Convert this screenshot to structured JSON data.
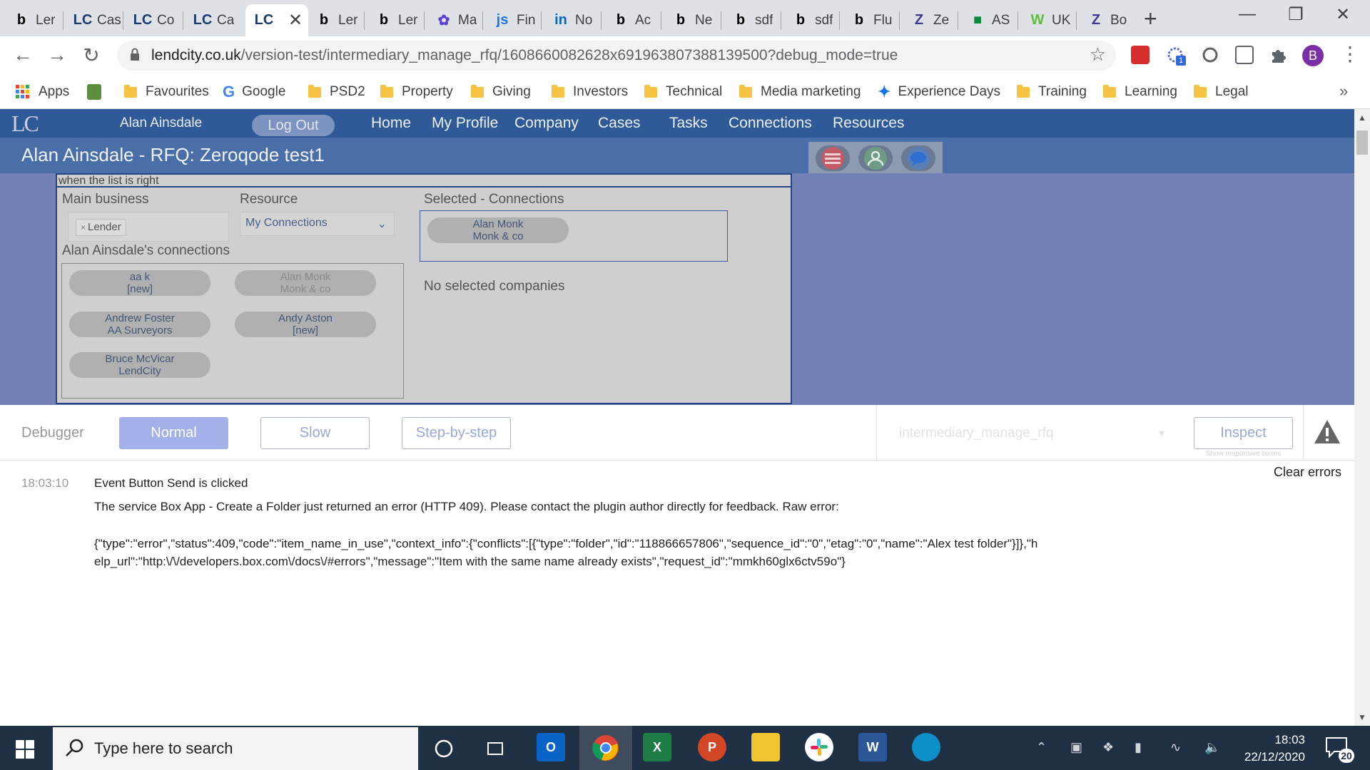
{
  "browser": {
    "tabs": [
      {
        "icon": "b",
        "title": "Ler",
        "color": "#000000"
      },
      {
        "icon": "LC",
        "title": "Cas",
        "color": "#1d3b6e"
      },
      {
        "icon": "LC",
        "title": "Co",
        "color": "#1d3b6e"
      },
      {
        "icon": "LC",
        "title": "Ca",
        "color": "#1d3b6e"
      },
      {
        "icon": "LC",
        "title": "",
        "color": "#1d3b6e",
        "active": true
      },
      {
        "icon": "b",
        "title": "Ler",
        "color": "#000000"
      },
      {
        "icon": "b",
        "title": "Ler",
        "color": "#000000"
      },
      {
        "icon": "✿",
        "title": "Ma",
        "color": "#5b3fd6"
      },
      {
        "icon": "js",
        "title": "Fin",
        "color": "#1a73e8"
      },
      {
        "icon": "in",
        "title": "No",
        "color": "#0a66c2"
      },
      {
        "icon": "b",
        "title": "Ac",
        "color": "#000000"
      },
      {
        "icon": "b",
        "title": "Ne",
        "color": "#000000"
      },
      {
        "icon": "b",
        "title": "sdf",
        "color": "#000000"
      },
      {
        "icon": "b",
        "title": "sdf",
        "color": "#000000"
      },
      {
        "icon": "b",
        "title": "Flu",
        "color": "#000000"
      },
      {
        "icon": "Z",
        "title": "Ze",
        "color": "#3b3b8f"
      },
      {
        "icon": "■",
        "title": "AS",
        "color": "#0f8a3b"
      },
      {
        "icon": "W",
        "title": "UK",
        "color": "#5fbf3a"
      },
      {
        "icon": "Z",
        "title": "Bo",
        "color": "#3b3b8f"
      }
    ],
    "url_host": "lendcity.co.uk",
    "url_path": "/version-test/intermediary_manage_rfq/1608660082628x691963807388139500?debug_mode=true",
    "profile_initial": "B",
    "extension_badge": "1"
  },
  "bookmarks": {
    "apps": "Apps",
    "items": [
      "Favourites",
      "Google",
      "PSD2",
      "Property",
      "Giving",
      "Investors",
      "Technical",
      "Media marketing",
      "Experience Days",
      "Training",
      "Learning",
      "Legal"
    ]
  },
  "app": {
    "logo": "LC",
    "user_name": "Alan Ainsdale",
    "logout": "Log Out",
    "nav": [
      "Home",
      "My Profile",
      "Company",
      "Cases",
      "Tasks",
      "Connections",
      "Resources"
    ],
    "page_title": "Alan Ainsdale -  RFQ: Zeroqode test1",
    "panel_note": "when the list is right",
    "main_business_label": "Main business",
    "main_business_tag": "Lender",
    "resource_label": "Resource",
    "resource_value": "My Connections",
    "connections_label": "Alan Ainsdale's connections",
    "connections": [
      {
        "name": "aa k",
        "sub": "[new]",
        "dim": false
      },
      {
        "name": "Alan Monk",
        "sub": "Monk & co",
        "dim": true
      },
      {
        "name": "Andrew Foster",
        "sub": "AA Surveyors",
        "dim": false
      },
      {
        "name": "Andy Aston",
        "sub": "[new]",
        "dim": false
      },
      {
        "name": "Bruce McVicar",
        "sub": "LendCity",
        "dim": false
      }
    ],
    "selected_label": "Selected - Connections",
    "selected": {
      "name": "Alan Monk",
      "sub": "Monk & co"
    },
    "no_companies": "No selected companies"
  },
  "debugger": {
    "label": "Debugger",
    "modes": [
      "Normal",
      "Slow",
      "Step-by-step"
    ],
    "active_mode": "Normal",
    "page_select": "intermediary_manage_rfq",
    "inspect": "Inspect",
    "inspect_sub": "Show responsive boxes",
    "clear_errors": "Clear errors"
  },
  "log": {
    "time": "18:03:10",
    "event": "Event Button Send is clicked",
    "message": "The service Box App - Create a Folder just returned an error (HTTP 409). Please contact the plugin author directly for feedback. Raw error:",
    "raw": "{\"type\":\"error\",\"status\":409,\"code\":\"item_name_in_use\",\"context_info\":{\"conflicts\":[{\"type\":\"folder\",\"id\":\"118866657806\",\"sequence_id\":\"0\",\"etag\":\"0\",\"name\":\"Alex test folder\"}]},\"help_url\":\"http:\\/\\/developers.box.com\\/docs\\/#errors\",\"message\":\"Item with the same name already exists\",\"request_id\":\"mmkh60glx6ctv59o\"}"
  },
  "taskbar": {
    "search_placeholder": "Type here to search",
    "time": "18:03",
    "date": "22/12/2020",
    "notification_count": "20"
  },
  "colors": {
    "nav_bg": "#2f5a97",
    "title_bg": "#4a6ea8",
    "main_bg": "#7282b7",
    "debug_active": "#a3b0ea"
  }
}
